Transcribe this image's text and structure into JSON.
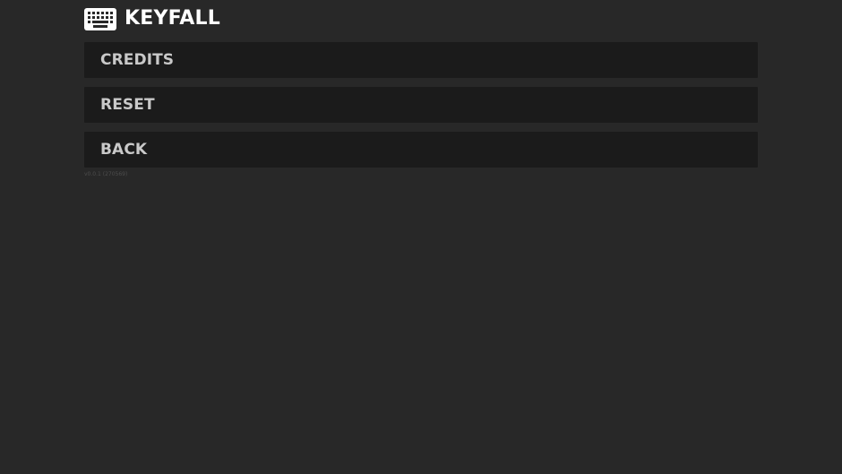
{
  "app": {
    "title": "KEYFALL",
    "logo_icon": "keyboard-icon"
  },
  "menu": {
    "items": [
      {
        "label": "CREDITS"
      },
      {
        "label": "RESET"
      },
      {
        "label": "BACK"
      }
    ]
  },
  "footer": {
    "version": "v0.0.1 (270569)"
  },
  "colors": {
    "background": "#282828",
    "button": "#1b1b1b",
    "button_text": "#c9c9c9",
    "title_text": "#ffffff"
  }
}
